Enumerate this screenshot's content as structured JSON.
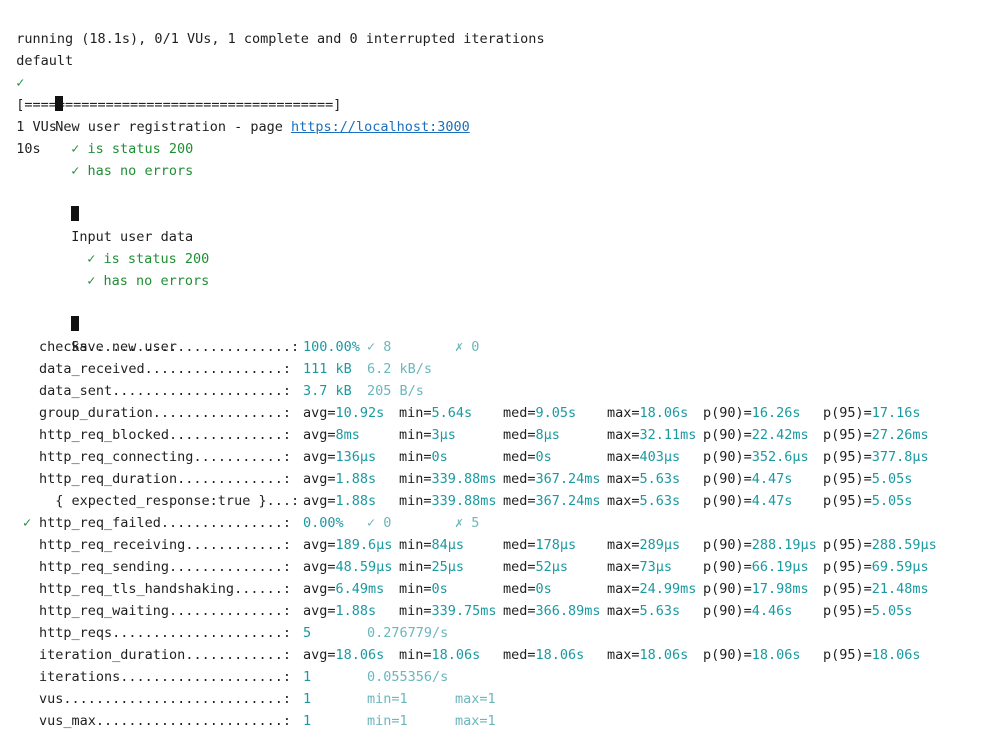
{
  "status": {
    "running": "running (18.1s), 0/1 VUs, 1 complete and 0 interrupted iterations",
    "default_label": "default",
    "check_mark": "✓",
    "progress": "[======================================]",
    "vus": "1 VUs",
    "duration": "10s"
  },
  "groups": [
    {
      "title": "New user registration - page ",
      "url": "https://localhost:3000",
      "checks": [
        "is status 200",
        "has no errors"
      ]
    },
    {
      "title": "Input user data",
      "checks": [
        "is status 200",
        "has no errors"
      ]
    },
    {
      "title": "Save new user",
      "checks": []
    }
  ],
  "metrics": [
    {
      "name": "checks",
      "dots": ".........................:",
      "mark": "",
      "cols": [
        "100.00%",
        "✓ 8",
        "✗ 0"
      ],
      "kind": "rate"
    },
    {
      "name": "data_received",
      "dots": ".................:",
      "mark": "",
      "cols": [
        "111 kB",
        "6.2 kB/s"
      ],
      "kind": "pair"
    },
    {
      "name": "data_sent",
      "dots": ".....................:",
      "mark": "",
      "cols": [
        "3.7 kB",
        "205 B/s"
      ],
      "kind": "pair"
    },
    {
      "name": "group_duration",
      "dots": "................:",
      "mark": "",
      "cols": [
        "avg=10.92s",
        "min=5.64s",
        "med=9.05s",
        "max=18.06s",
        "p(90)=16.26s",
        "p(95)=17.16s"
      ],
      "kind": "trend"
    },
    {
      "name": "http_req_blocked",
      "dots": "..............:",
      "mark": "",
      "cols": [
        "avg=8ms",
        "min=3µs",
        "med=8µs",
        "max=32.11ms",
        "p(90)=22.42ms",
        "p(95)=27.26ms"
      ],
      "kind": "trend"
    },
    {
      "name": "http_req_connecting",
      "dots": "...........:",
      "mark": "",
      "cols": [
        "avg=136µs",
        "min=0s",
        "med=0s",
        "max=403µs",
        "p(90)=352.6µs",
        "p(95)=377.8µs"
      ],
      "kind": "trend"
    },
    {
      "name": "http_req_duration",
      "dots": ".............:",
      "mark": "",
      "cols": [
        "avg=1.88s",
        "min=339.88ms",
        "med=367.24ms",
        "max=5.63s",
        "p(90)=4.47s",
        "p(95)=5.05s"
      ],
      "kind": "trend"
    },
    {
      "name": "  { expected_response:true }",
      "dots": "...:",
      "mark": "",
      "cols": [
        "avg=1.88s",
        "min=339.88ms",
        "med=367.24ms",
        "max=5.63s",
        "p(90)=4.47s",
        "p(95)=5.05s"
      ],
      "kind": "trend"
    },
    {
      "name": "http_req_failed",
      "dots": "...............:",
      "mark": "✓",
      "cols": [
        "0.00%",
        "✓ 0",
        "✗ 5"
      ],
      "kind": "rate"
    },
    {
      "name": "http_req_receiving",
      "dots": "............:",
      "mark": "",
      "cols": [
        "avg=189.6µs",
        "min=84µs",
        "med=178µs",
        "max=289µs",
        "p(90)=288.19µs",
        "p(95)=288.59µs"
      ],
      "kind": "trend"
    },
    {
      "name": "http_req_sending",
      "dots": "..............:",
      "mark": "",
      "cols": [
        "avg=48.59µs",
        "min=25µs",
        "med=52µs",
        "max=73µs",
        "p(90)=66.19µs",
        "p(95)=69.59µs"
      ],
      "kind": "trend"
    },
    {
      "name": "http_req_tls_handshaking",
      "dots": "......:",
      "mark": "",
      "cols": [
        "avg=6.49ms",
        "min=0s",
        "med=0s",
        "max=24.99ms",
        "p(90)=17.98ms",
        "p(95)=21.48ms"
      ],
      "kind": "trend"
    },
    {
      "name": "http_req_waiting",
      "dots": "..............:",
      "mark": "",
      "cols": [
        "avg=1.88s",
        "min=339.75ms",
        "med=366.89ms",
        "max=5.63s",
        "p(90)=4.46s",
        "p(95)=5.05s"
      ],
      "kind": "trend"
    },
    {
      "name": "http_reqs",
      "dots": ".....................:",
      "mark": "",
      "cols": [
        "5",
        "0.276779/s"
      ],
      "kind": "pair"
    },
    {
      "name": "iteration_duration",
      "dots": "............:",
      "mark": "",
      "cols": [
        "avg=18.06s",
        "min=18.06s",
        "med=18.06s",
        "max=18.06s",
        "p(90)=18.06s",
        "p(95)=18.06s"
      ],
      "kind": "trend"
    },
    {
      "name": "iterations",
      "dots": "....................:",
      "mark": "",
      "cols": [
        "1",
        "0.055356/s"
      ],
      "kind": "pair"
    },
    {
      "name": "vus",
      "dots": "...........................:",
      "mark": "",
      "cols": [
        "1",
        "min=1",
        "max=1"
      ],
      "kind": "rate"
    },
    {
      "name": "vus_max",
      "dots": ".......................:",
      "mark": "",
      "cols": [
        "1",
        "min=1",
        "max=1"
      ],
      "kind": "rate"
    }
  ],
  "colors": {
    "check": "#1f8f34",
    "value": "#1a9aa0",
    "value_light": "#6ab7bc",
    "link": "#1a6fbf"
  }
}
